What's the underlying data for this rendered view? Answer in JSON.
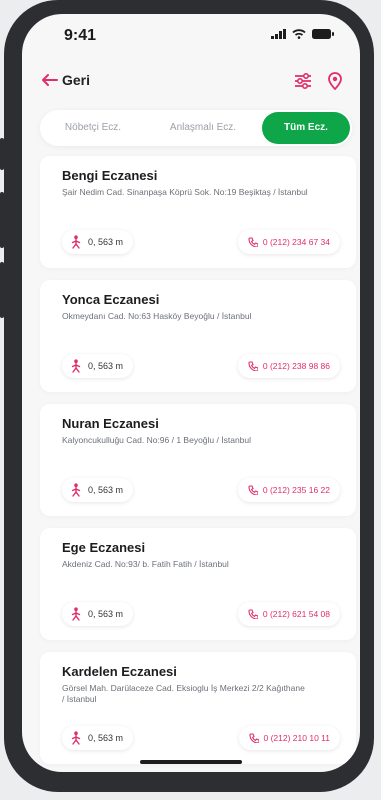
{
  "status_bar": {
    "time": "9:41"
  },
  "header": {
    "back_label": "Geri"
  },
  "tabs": [
    {
      "label": "Nöbetçi Ecz."
    },
    {
      "label": "Anlaşmalı Ecz."
    },
    {
      "label": "Tüm Ecz.",
      "active": true
    }
  ],
  "pharmacies": [
    {
      "name": "Bengi Eczanesi",
      "address": "Şair Nedim Cad. Sinanpaşa Köprü Sok. No:19 Beşiktaş / İstanbul",
      "distance": "0, 563 m",
      "phone": "0 (212) 234 67 34"
    },
    {
      "name": "Yonca Eczanesi",
      "address": "Okmeydanı Cad. No:63 Hasköy Beyoğlu / İstanbul",
      "distance": "0, 563 m",
      "phone": "0 (212) 238 98 86"
    },
    {
      "name": "Nuran Eczanesi",
      "address": "Kalyoncukulluğu Cad. No:96 / 1 Beyoğlu / İstanbul",
      "distance": "0, 563 m",
      "phone": "0 (212) 235 16 22"
    },
    {
      "name": "Ege Eczanesi",
      "address": "Akdeniz Cad. No:93/ b. Fatih Fatih / İstanbul",
      "distance": "0, 563 m",
      "phone": "0 (212) 621 54 08"
    },
    {
      "name": "Kardelen Eczanesi",
      "address": "Görsel Mah. Darülaceze Cad. Eksioglu İş Merkezi 2/2 Kağıthane / İstanbul",
      "distance": "0, 563 m",
      "phone": "0 (212) 210 10 11"
    }
  ],
  "colors": {
    "accent_green": "#0fa64a",
    "accent_pink": "#e02d6d"
  },
  "icons": [
    "signal-icon",
    "wifi-icon",
    "battery-icon",
    "back-arrow-icon",
    "filter-icon",
    "location-pin-icon",
    "walking-person-icon",
    "phone-icon"
  ]
}
